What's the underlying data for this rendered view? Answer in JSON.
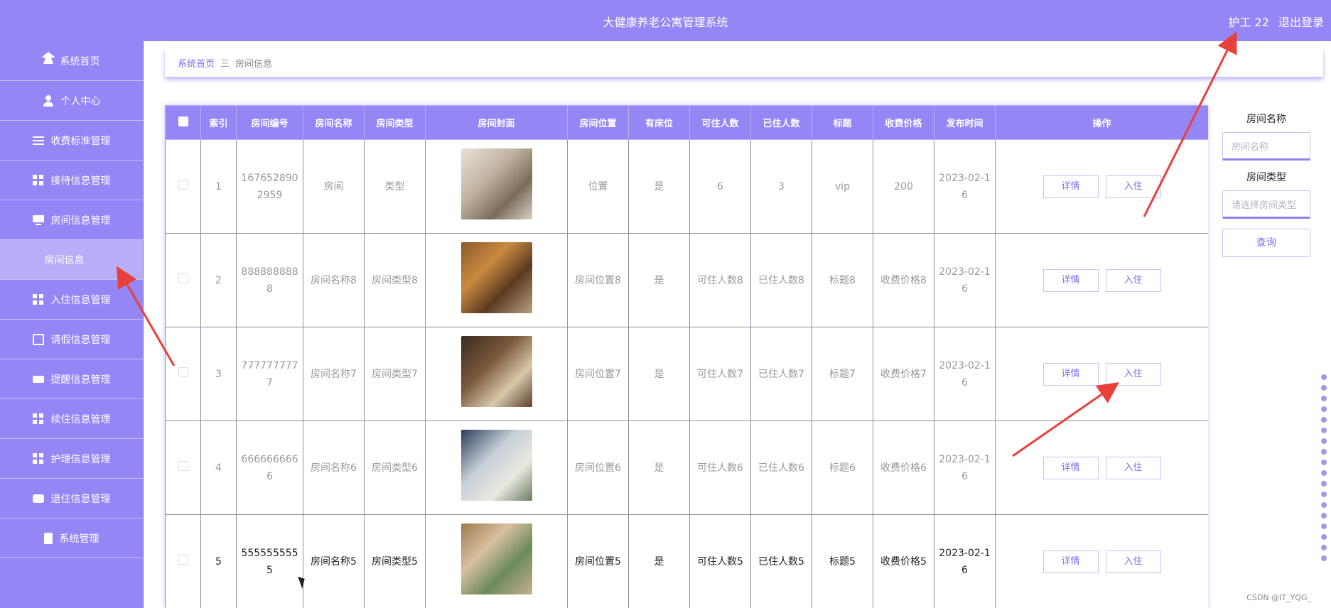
{
  "header": {
    "title": "大健康养老公寓管理系统",
    "user": "护工 22",
    "logout": "退出登录"
  },
  "sidebar": {
    "items": [
      {
        "label": "系统首页",
        "icon": "home-icon"
      },
      {
        "label": "个人中心",
        "icon": "user-icon"
      },
      {
        "label": "收费标准管理",
        "icon": "list-icon"
      },
      {
        "label": "接待信息管理",
        "icon": "grid-icon"
      },
      {
        "label": "房间信息管理",
        "icon": "monitor-icon"
      },
      {
        "label": "房间信息",
        "icon": "",
        "sub": true
      },
      {
        "label": "入住信息管理",
        "icon": "grid-icon"
      },
      {
        "label": "请假信息管理",
        "icon": "chart-icon"
      },
      {
        "label": "提醒信息管理",
        "icon": "ticket-icon"
      },
      {
        "label": "续住信息管理",
        "icon": "grid-icon"
      },
      {
        "label": "护理信息管理",
        "icon": "grid-icon"
      },
      {
        "label": "退住信息管理",
        "icon": "chat-icon"
      },
      {
        "label": "系统管理",
        "icon": "clipboard-icon"
      }
    ]
  },
  "breadcrumb": {
    "home": "系统首页",
    "sep": "三",
    "current": "房间信息"
  },
  "table": {
    "headers": [
      "",
      "索引",
      "房间编号",
      "房间名称",
      "房间类型",
      "房间封面",
      "房间位置",
      "有床位",
      "可住人数",
      "已住人数",
      "标题",
      "收费价格",
      "发布时间",
      "操作"
    ],
    "detail_label": "详情",
    "checkin_label": "入住",
    "rows": [
      {
        "index": "1",
        "number": "1676528902959",
        "name": "房间",
        "type": "类型",
        "location": "位置",
        "has_bed": "是",
        "capacity": "6",
        "occupied": "3",
        "title": "vip",
        "price": "200",
        "date": "2023-02-16"
      },
      {
        "index": "2",
        "number": "8888888888",
        "name": "房间名称8",
        "type": "房间类型8",
        "location": "房间位置8",
        "has_bed": "是",
        "capacity": "可住人数8",
        "occupied": "已住人数8",
        "title": "标题8",
        "price": "收费价格8",
        "date": "2023-02-16"
      },
      {
        "index": "3",
        "number": "7777777777",
        "name": "房间名称7",
        "type": "房间类型7",
        "location": "房间位置7",
        "has_bed": "是",
        "capacity": "可住人数7",
        "occupied": "已住人数7",
        "title": "标题7",
        "price": "收费价格7",
        "date": "2023-02-16"
      },
      {
        "index": "4",
        "number": "6666666666",
        "name": "房间名称6",
        "type": "房间类型6",
        "location": "房间位置6",
        "has_bed": "是",
        "capacity": "可住人数6",
        "occupied": "已住人数6",
        "title": "标题6",
        "price": "收费价格6",
        "date": "2023-02-16"
      },
      {
        "index": "5",
        "number": "5555555555",
        "name": "房间名称5",
        "type": "房间类型5",
        "location": "房间位置5",
        "has_bed": "是",
        "capacity": "可住人数5",
        "occupied": "已住人数5",
        "title": "标题5",
        "price": "收费价格5",
        "date": "2023-02-16"
      }
    ]
  },
  "search": {
    "name_label": "房间名称",
    "name_placeholder": "房间名称",
    "type_label": "房间类型",
    "type_placeholder": "请选择房间类型",
    "query_label": "查询"
  },
  "watermark": "CSDN @IT_YQG_",
  "colors": {
    "primary": "#9486f5",
    "annotation_arrow": "#e8403a"
  }
}
